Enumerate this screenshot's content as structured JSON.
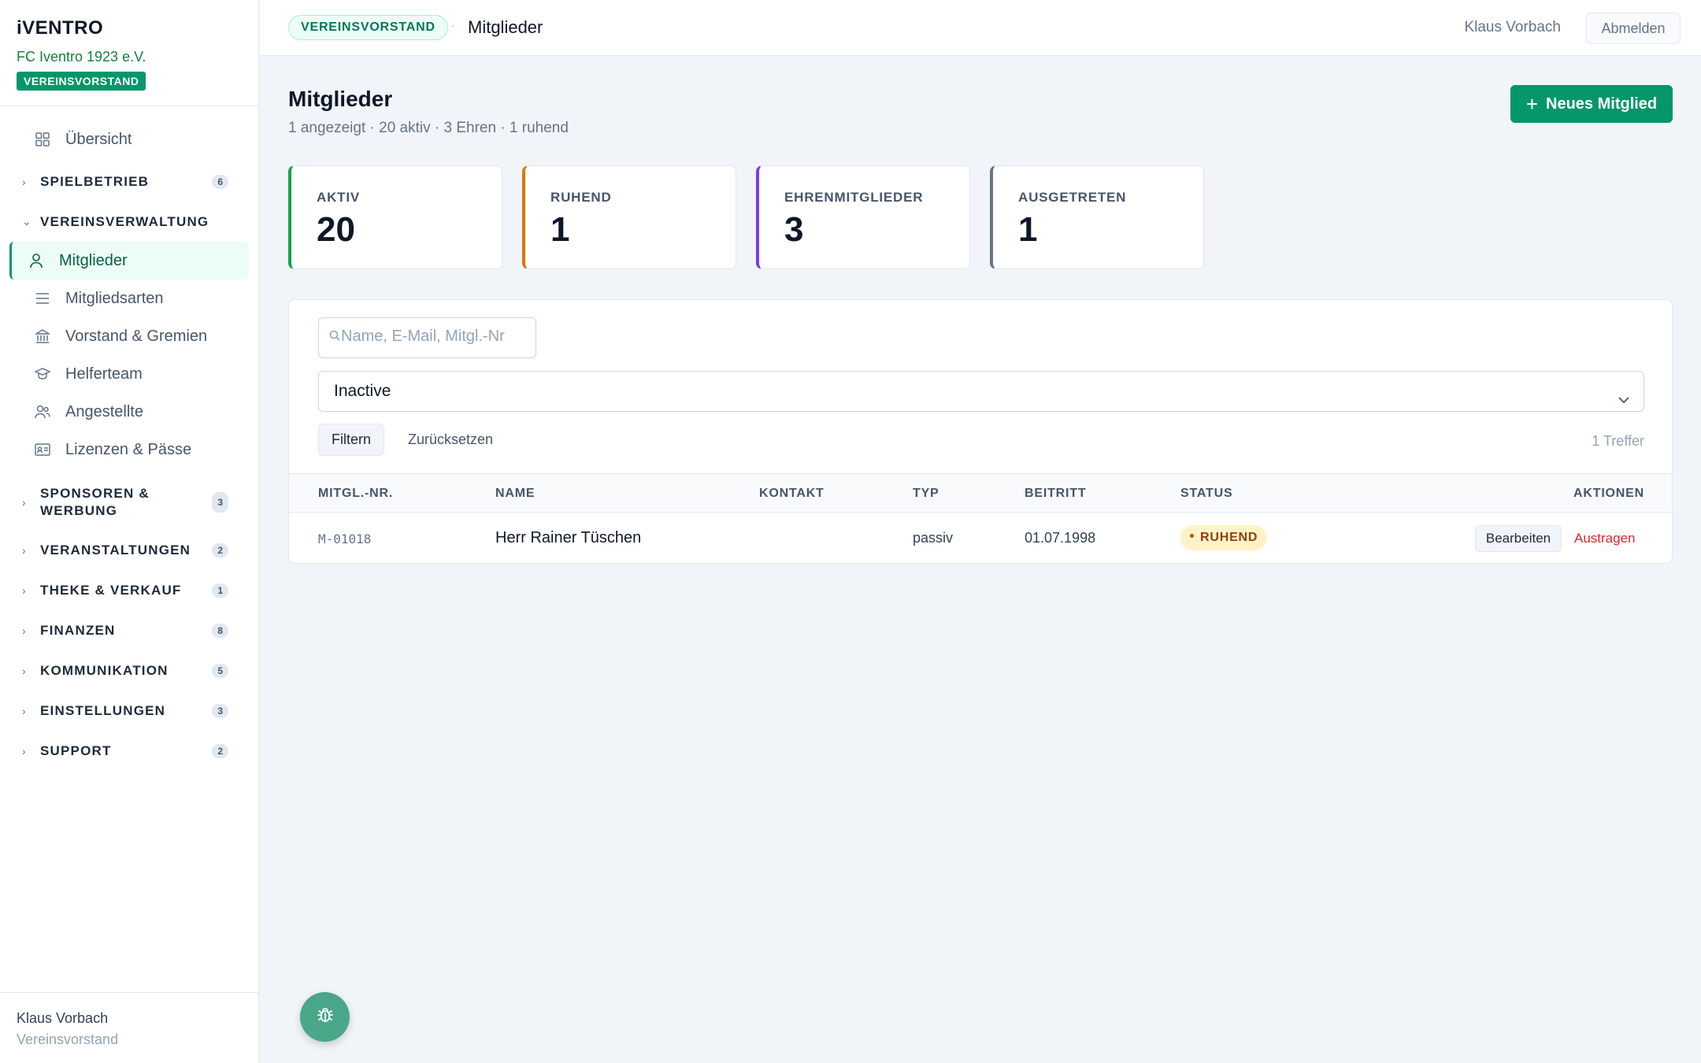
{
  "brand": {
    "logo": "iVENTRO",
    "club": "FC Iventro 1923 e.V.",
    "role_badge": "VEREINSVORSTAND"
  },
  "sidebar": {
    "overview": "Übersicht",
    "groups": [
      {
        "label": "SPIELBETRIEB",
        "count": "6"
      },
      {
        "label": "VEREINSVERWALTUNG"
      },
      {
        "label": "SPONSOREN & WERBUNG",
        "count": "3"
      },
      {
        "label": "VERANSTALTUNGEN",
        "count": "2"
      },
      {
        "label": "THEKE & VERKAUF",
        "count": "1"
      },
      {
        "label": "FINANZEN",
        "count": "8"
      },
      {
        "label": "KOMMUNIKATION",
        "count": "5"
      },
      {
        "label": "EINSTELLUNGEN",
        "count": "3"
      },
      {
        "label": "SUPPORT",
        "count": "2"
      }
    ],
    "items": [
      {
        "label": "Mitglieder",
        "icon": "user-icon"
      },
      {
        "label": "Mitgliedsarten",
        "icon": "list-icon"
      },
      {
        "label": "Vorstand & Gremien",
        "icon": "building-icon"
      },
      {
        "label": "Helferteam",
        "icon": "graduation-cap-icon"
      },
      {
        "label": "Angestellte",
        "icon": "users-icon"
      },
      {
        "label": "Lizenzen & Pässe",
        "icon": "id-card-icon"
      }
    ],
    "footer": {
      "name": "Klaus Vorbach",
      "role": "Vereinsvorstand"
    }
  },
  "topbar": {
    "badge": "VEREINSVORSTAND",
    "separator": "·",
    "page": "Mitglieder",
    "user": "Klaus Vorbach",
    "logout": "Abmelden"
  },
  "header": {
    "title": "Mitglieder",
    "subtitle": "1 angezeigt · 20 aktiv · 3 Ehren · 1 ruhend",
    "new_button": "Neues Mitglied"
  },
  "stats": [
    {
      "label": "AKTIV",
      "value": "20",
      "color": "#16a34a"
    },
    {
      "label": "RUHEND",
      "value": "1",
      "color": "#d97706"
    },
    {
      "label": "EHRENMITGLIEDER",
      "value": "3",
      "color": "#7c3aed"
    },
    {
      "label": "AUSGETRETEN",
      "value": "1",
      "color": "#64748b"
    }
  ],
  "filters": {
    "search_placeholder": "Name, E-Mail, Mitgl.-Nr",
    "search_value": "",
    "status_selected": "Inactive",
    "filter_button": "Filtern",
    "reset_button": "Zurücksetzen",
    "hits": "1 Treffer"
  },
  "table": {
    "headers": [
      "MITGL.-NR.",
      "NAME",
      "KONTAKT",
      "TYP",
      "BEITRITT",
      "STATUS",
      "AKTIONEN"
    ],
    "rows": [
      {
        "nr": "M-01018",
        "name": "Herr Rainer Tüschen",
        "kontakt": "",
        "typ": "passiv",
        "beitritt": "01.07.1998",
        "status": "RUHEND",
        "edit": "Bearbeiten",
        "remove": "Austragen"
      }
    ]
  },
  "colors": {
    "accent": "#059669",
    "danger": "#dc2626",
    "status_ruhend_bg": "#fef3c7"
  }
}
